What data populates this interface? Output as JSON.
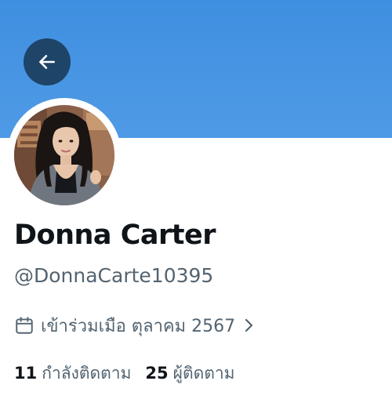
{
  "header": {
    "banner_color": "#4a97e3",
    "back_button_color": "#1e4468",
    "back_icon": "arrow-left-icon"
  },
  "profile": {
    "display_name": "Donna Carter",
    "handle": "@DonnaCarte10395",
    "joined": "เข้าร่วมเมือ ตุลาคม 2567",
    "joined_icon": "calendar-icon",
    "joined_chevron_icon": "chevron-right-icon"
  },
  "stats": {
    "following_count": "11",
    "following_label": "กำลังติดตาม",
    "followers_count": "25",
    "followers_label": "ผู้ติดตาม"
  }
}
